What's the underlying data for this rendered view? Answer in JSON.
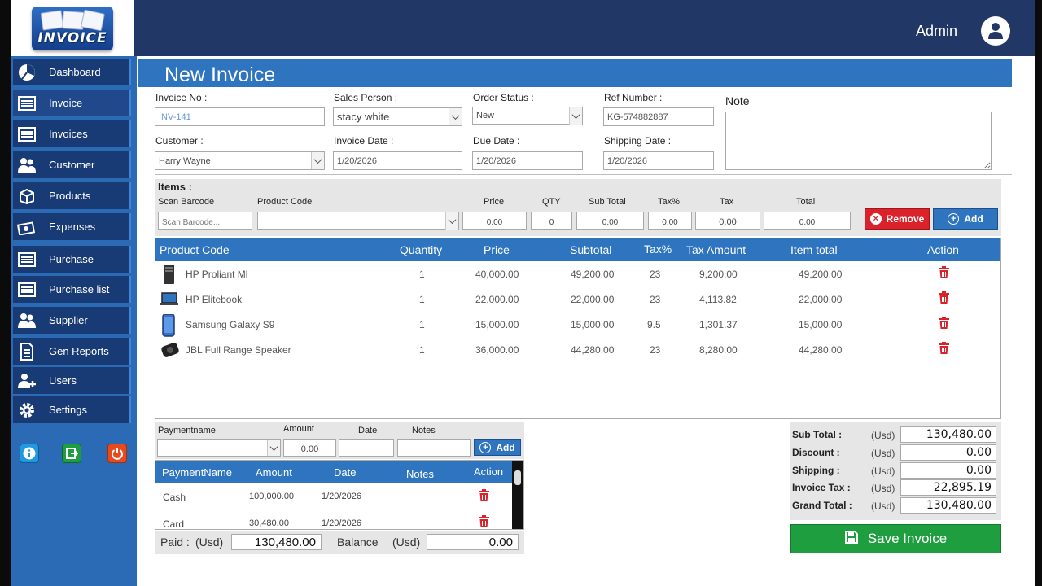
{
  "header": {
    "admin_name": "Admin",
    "logo_text": "INVOICE"
  },
  "sidebar": {
    "items": [
      {
        "label": "Dashboard",
        "icon": "dashboard-icon"
      },
      {
        "label": "Invoice",
        "icon": "invoice-icon"
      },
      {
        "label": "Invoices",
        "icon": "invoices-icon"
      },
      {
        "label": "Customer",
        "icon": "customer-icon"
      },
      {
        "label": "Products",
        "icon": "products-icon"
      },
      {
        "label": "Expenses",
        "icon": "expenses-icon"
      },
      {
        "label": "Purchase",
        "icon": "purchase-icon"
      },
      {
        "label": "Purchase list",
        "icon": "purchase-list-icon"
      },
      {
        "label": "Supplier",
        "icon": "supplier-icon"
      },
      {
        "label": "Gen Reports",
        "icon": "reports-icon"
      },
      {
        "label": "Users",
        "icon": "users-icon"
      },
      {
        "label": "Settings",
        "icon": "settings-icon"
      }
    ]
  },
  "page": {
    "title": "New Invoice"
  },
  "form": {
    "invoice_no_label": "Invoice No :",
    "invoice_no": "INV-141",
    "sales_person_label": "Sales Person :",
    "sales_person": "stacy white",
    "order_status_label": "Order Status :",
    "order_status": "New",
    "ref_number_label": "Ref Number :",
    "ref_number": "KG-574882887",
    "note_label": "Note",
    "customer_label": "Customer :",
    "customer": "Harry Wayne",
    "invoice_date_label": "Invoice Date :",
    "invoice_date": "1/20/2026",
    "due_date_label": "Due Date :",
    "due_date": "1/20/2026",
    "shipping_date_label": "Shipping Date :",
    "shipping_date": "1/20/2026"
  },
  "items_entry": {
    "section_label": "Items :",
    "scan_barcode_label": "Scan Barcode",
    "scan_barcode_placeholder": "Scan Barcode...",
    "product_code_label": "Product Code",
    "price_label": "Price",
    "price": "0.00",
    "qty_label": "QTY",
    "qty": "0",
    "subtotal_label": "Sub Total",
    "subtotal": "0.00",
    "taxpct_label": "Tax%",
    "taxpct": "0.00",
    "tax_label": "Tax",
    "tax": "0.00",
    "total_label": "Total",
    "total": "0.00",
    "remove_label": "Remove",
    "add_label": "Add"
  },
  "items_table": {
    "headers": [
      "Product Code",
      "Quantity",
      "Price",
      "Subtotal",
      "Tax%",
      "Tax Amount",
      "Item total",
      "Action"
    ],
    "rows": [
      {
        "product": "HP Proliant Ml",
        "qty": "1",
        "price": "40,000.00",
        "subtotal": "49,200.00",
        "taxpct": "23",
        "tax": "9,200.00",
        "total": "49,200.00",
        "thumb": "server"
      },
      {
        "product": "HP Elitebook",
        "qty": "1",
        "price": "22,000.00",
        "subtotal": "22,000.00",
        "taxpct": "23",
        "tax": "4,113.82",
        "total": "22,000.00",
        "thumb": "laptop"
      },
      {
        "product": "Samsung Galaxy S9",
        "qty": "1",
        "price": "15,000.00",
        "subtotal": "15,000.00",
        "taxpct": "9.5",
        "tax": "1,301.37",
        "total": "15,000.00",
        "thumb": "phone"
      },
      {
        "product": "JBL Full Range Speaker",
        "qty": "1",
        "price": "36,000.00",
        "subtotal": "44,280.00",
        "taxpct": "23",
        "tax": "8,280.00",
        "total": "44,280.00",
        "thumb": "speaker"
      }
    ]
  },
  "payment_entry": {
    "name_label": "Paymentname",
    "amount_label": "Amount",
    "amount": "0.00",
    "date_label": "Date",
    "notes_label": "Notes",
    "add_label": "Add"
  },
  "payments_table": {
    "headers": [
      "PaymentName",
      "Amount",
      "Date",
      "Notes",
      "Action"
    ],
    "rows": [
      {
        "name": "Cash",
        "amount": "100,000.00",
        "date": "1/20/2026"
      },
      {
        "name": "Card",
        "amount": "30,480.00",
        "date": "1/20/2026"
      }
    ]
  },
  "paid": {
    "label": "Paid :",
    "currency": "(Usd)",
    "value": "130,480.00",
    "balance_label": "Balance",
    "balance_currency": "(Usd)",
    "balance_value": "0.00"
  },
  "totals": {
    "currency": "(Usd)",
    "rows": [
      {
        "label": "Sub Total :",
        "value": "130,480.00"
      },
      {
        "label": "Discount :",
        "value": "0.00"
      },
      {
        "label": "Shipping  :",
        "value": "0.00"
      },
      {
        "label": "Invoice Tax :",
        "value": "22,895.19"
      },
      {
        "label": "Grand Total :",
        "value": "130,480.00"
      }
    ]
  },
  "save_label": "Save Invoice",
  "colors": {
    "header": "#213867",
    "sidebar": "#2b6ab5",
    "accent": "#2e74bf",
    "danger": "#d9222a",
    "success": "#1e9e3e"
  }
}
